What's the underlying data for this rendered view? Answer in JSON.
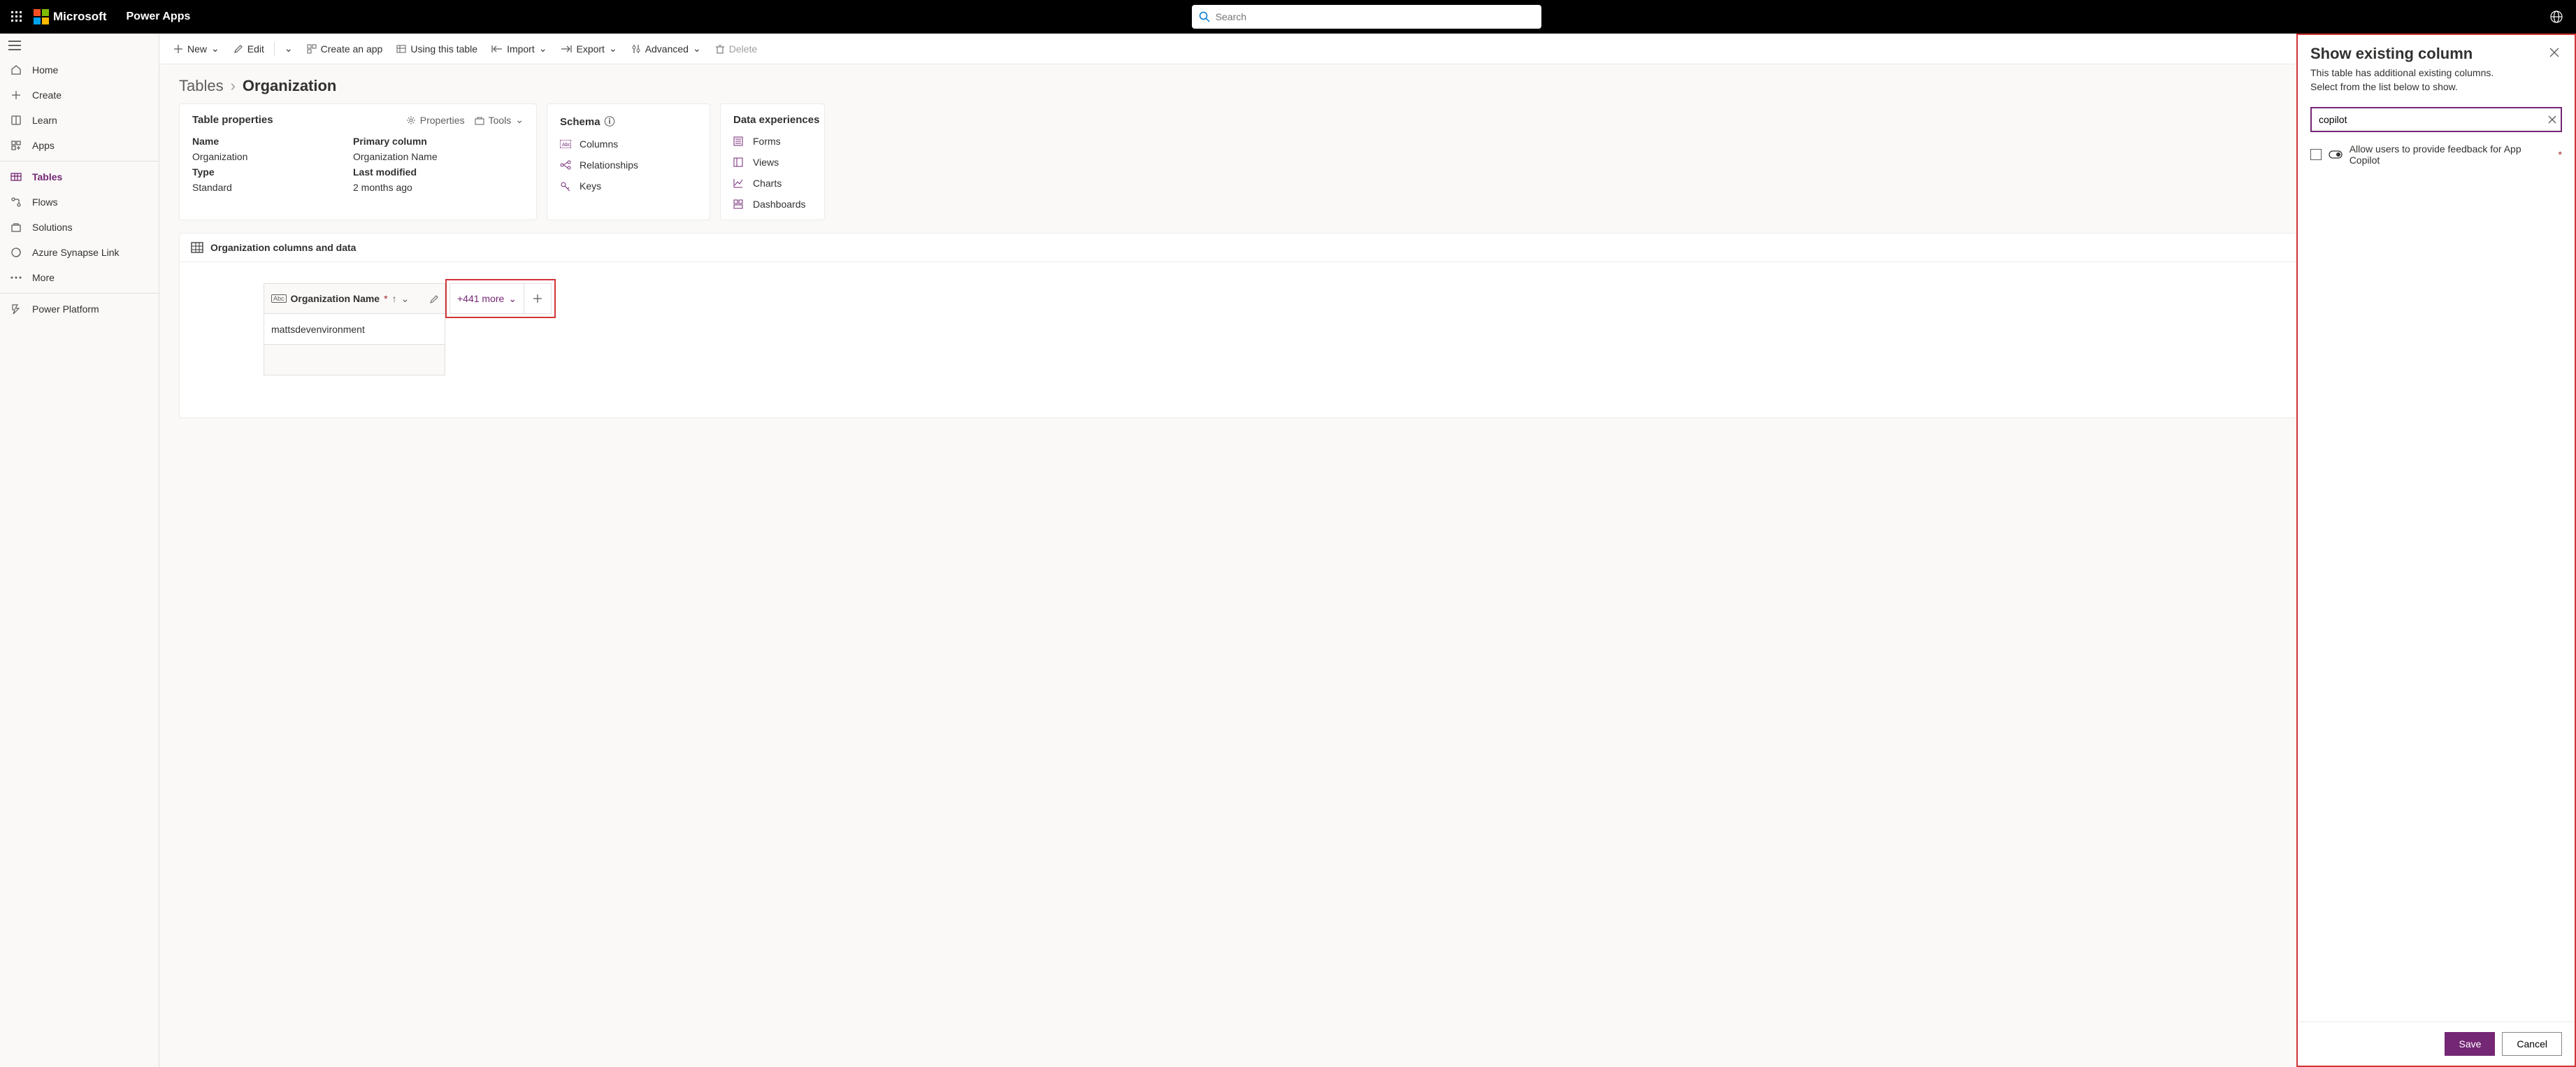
{
  "header": {
    "brand": "Microsoft",
    "app": "Power Apps",
    "search_placeholder": "Search"
  },
  "nav": {
    "items": [
      {
        "icon": "home",
        "label": "Home"
      },
      {
        "icon": "plus",
        "label": "Create"
      },
      {
        "icon": "book",
        "label": "Learn"
      },
      {
        "icon": "apps",
        "label": "Apps"
      },
      {
        "icon": "tables",
        "label": "Tables",
        "active": true
      },
      {
        "icon": "flows",
        "label": "Flows"
      },
      {
        "icon": "solutions",
        "label": "Solutions"
      },
      {
        "icon": "synapse",
        "label": "Azure Synapse Link"
      },
      {
        "icon": "more",
        "label": "More"
      },
      {
        "icon": "pp",
        "label": "Power Platform"
      }
    ]
  },
  "cmdbar": {
    "new": "New",
    "edit": "Edit",
    "create_app": "Create an app",
    "using_table": "Using this table",
    "import": "Import",
    "export": "Export",
    "advanced": "Advanced",
    "delete": "Delete"
  },
  "breadcrumb": {
    "root": "Tables",
    "leaf": "Organization"
  },
  "cards": {
    "props": {
      "title": "Table properties",
      "actions": {
        "properties": "Properties",
        "tools": "Tools"
      },
      "name_label": "Name",
      "name_value": "Organization",
      "primary_label": "Primary column",
      "primary_value": "Organization Name",
      "type_label": "Type",
      "type_value": "Standard",
      "modified_label": "Last modified",
      "modified_value": "2 months ago"
    },
    "schema": {
      "title": "Schema",
      "items": [
        {
          "icon": "columns",
          "label": "Columns"
        },
        {
          "icon": "rel",
          "label": "Relationships"
        },
        {
          "icon": "keys",
          "label": "Keys"
        }
      ]
    },
    "dexp": {
      "title": "Data experiences",
      "items": [
        {
          "icon": "forms",
          "label": "Forms"
        },
        {
          "icon": "views",
          "label": "Views"
        },
        {
          "icon": "charts",
          "label": "Charts"
        },
        {
          "icon": "dash",
          "label": "Dashboards"
        }
      ]
    }
  },
  "section": {
    "title": "Organization columns and data",
    "column_header": "Organization Name",
    "row1": "mattsdevenvironment",
    "more": "+441 more"
  },
  "panel": {
    "title": "Show existing column",
    "sub1": "This table has additional existing columns.",
    "sub2": "Select from the list below to show.",
    "search_value": "copilot",
    "result": "Allow users to provide feedback for App Copilot",
    "save": "Save",
    "cancel": "Cancel"
  }
}
